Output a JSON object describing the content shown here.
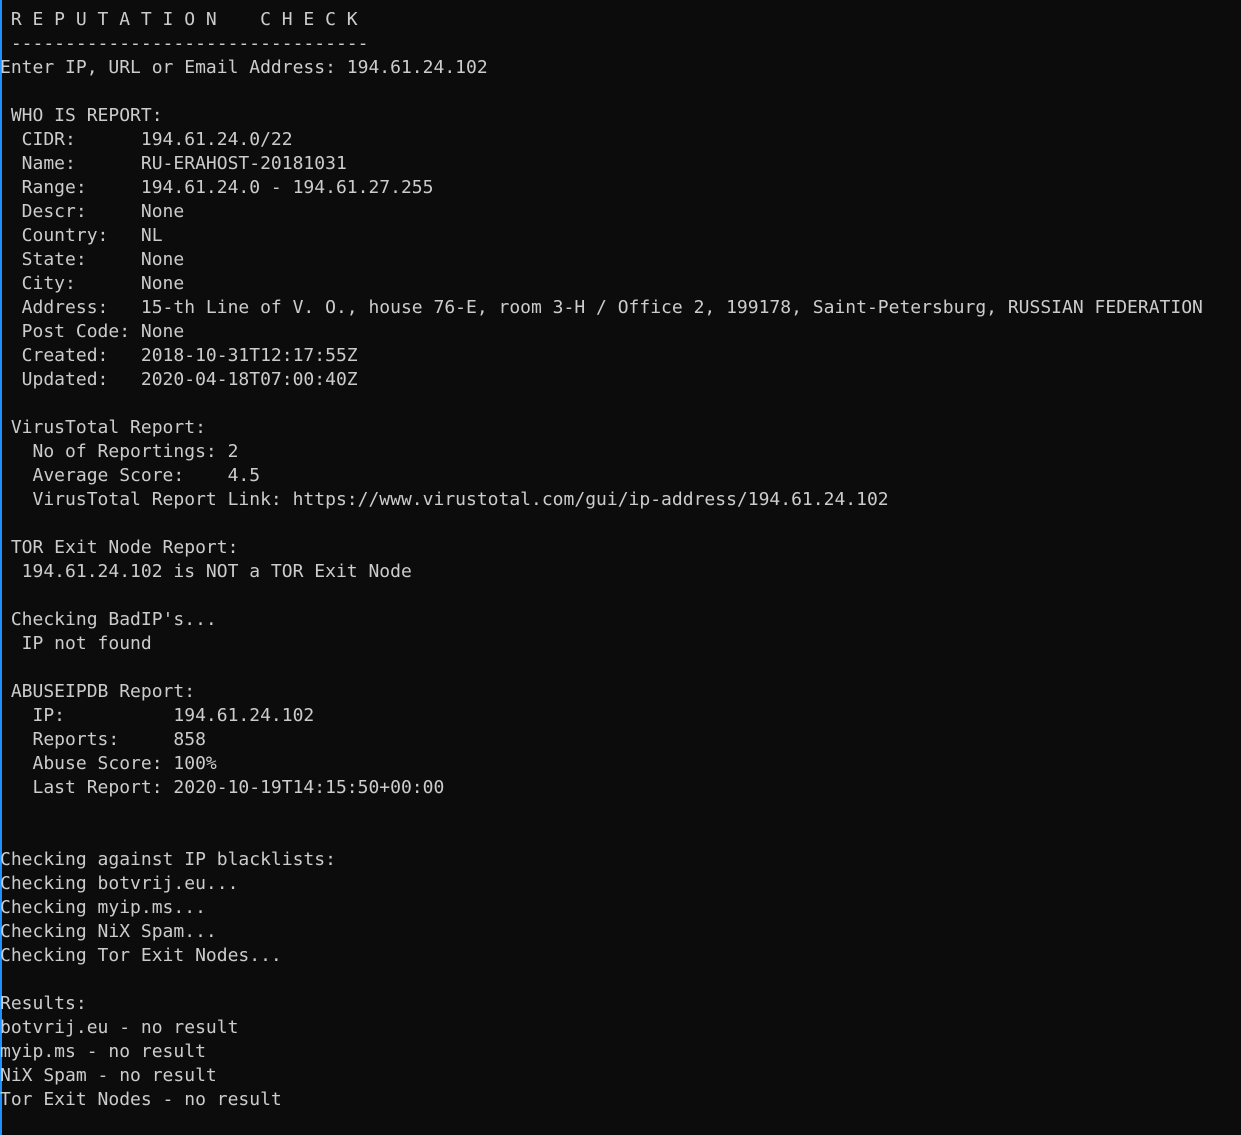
{
  "terminal": {
    "lines": [
      " ---------------------------------",
      " R E P U T A T I O N    C H E C K",
      " ---------------------------------",
      "Enter IP, URL or Email Address: 194.61.24.102",
      "",
      " WHO IS REPORT:",
      "  CIDR:      194.61.24.0/22",
      "  Name:      RU-ERAHOST-20181031",
      "  Range:     194.61.24.0 - 194.61.27.255",
      "  Descr:     None",
      "  Country:   NL",
      "  State:     None",
      "  City:      None",
      "  Address:   15-th Line of V. O., house 76-E, room 3-H / Office 2, 199178, Saint-Petersburg, RUSSIAN FEDERATION",
      "  Post Code: None",
      "  Created:   2018-10-31T12:17:55Z",
      "  Updated:   2020-04-18T07:00:40Z",
      "",
      " VirusTotal Report:",
      "   No of Reportings: 2",
      "   Average Score:    4.5",
      "   VirusTotal Report Link: https://www.virustotal.com/gui/ip-address/194.61.24.102",
      "",
      " TOR Exit Node Report:",
      "  194.61.24.102 is NOT a TOR Exit Node",
      "",
      " Checking BadIP's...",
      "  IP not found",
      "",
      " ABUSEIPDB Report:",
      "   IP:          194.61.24.102",
      "   Reports:     858",
      "   Abuse Score: 100%",
      "   Last Report: 2020-10-19T14:15:50+00:00",
      "",
      "",
      "Checking against IP blacklists:",
      "Checking botvrij.eu...",
      "Checking myip.ms...",
      "Checking NiX Spam...",
      "Checking Tor Exit Nodes...",
      "",
      "Results:",
      "botvrij.eu - no result",
      "myip.ms - no result",
      "NiX Spam - no result",
      "Tor Exit Nodes - no result"
    ]
  },
  "colors": {
    "background": "#0c0c0c",
    "text": "#cccccc",
    "window_edge": "#1e90ff"
  }
}
